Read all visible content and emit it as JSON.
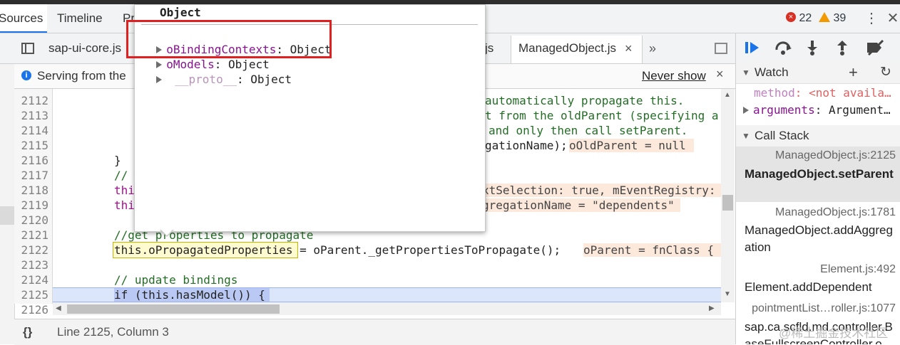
{
  "devtools_tabs": [
    "Sources",
    "Timeline",
    "Pr"
  ],
  "counts": {
    "errors": "22",
    "warnings": "39"
  },
  "file_tabs": [
    "sap-ui-core.js",
    "js",
    "ManagedObject.js",
    "»"
  ],
  "infobar": {
    "text": "Serving from the",
    "never_show": "Never show",
    "close": "×"
  },
  "popover": {
    "title": "Object",
    "rows": [
      {
        "name": "oBindingContexts",
        "value": ": Object"
      },
      {
        "name": "oModels",
        "value": ": Object"
      },
      {
        "name": "__proto__",
        "value": ": Object"
      }
    ]
  },
  "code": {
    "lines": [
      {
        "n": "2112",
        "text": "automatically propagate this."
      },
      {
        "n": "2113",
        "text": "t from the oldParent (specifying a"
      },
      {
        "n": "2114",
        "text": "and only then call setParent."
      },
      {
        "n": "2115",
        "text": "gationName);"
      },
      {
        "n": "2116",
        "text": "}"
      },
      {
        "n": "2117",
        "text": "//"
      },
      {
        "n": "2118",
        "text": "thi",
        "tail": "xtSelection: true, mEventRegistry:"
      },
      {
        "n": "2119",
        "text": "thi",
        "tail": "gregationName = \"dependents\""
      },
      {
        "n": "2120",
        "text": ""
      },
      {
        "n": "2121",
        "text": "//get properties to propagate"
      },
      {
        "n": "2122",
        "text": "this.oPropagatedProperties = oParent._getPropertiesToPropagate();"
      },
      {
        "n": "2123",
        "text": ""
      },
      {
        "n": "2124",
        "text": "// update bindings"
      },
      {
        "n": "2125",
        "text": "if (this.hasModel()) {"
      },
      {
        "n": "2126",
        "text": ""
      }
    ],
    "inline_values": {
      "l2115": "oOldParent = null",
      "l2122": "oParent = fnClass {"
    }
  },
  "statusbar": {
    "braces": "{}",
    "position": "Line 2125, Column 3"
  },
  "watch": {
    "title": "Watch",
    "items": [
      {
        "name": "method",
        "value": ": <not availa…"
      },
      {
        "name": "arguments",
        "value": ": Argument…"
      }
    ]
  },
  "call_stack": {
    "title": "Call Stack",
    "frames": [
      {
        "file": "ManagedObject.js:2125",
        "fn": "ManagedObject.setParent"
      },
      {
        "file": "ManagedObject.js:1781",
        "fn": "ManagedObject.addAggregation"
      },
      {
        "file": "Element.js:492",
        "fn": "Element.addDependent"
      },
      {
        "file": "pointmentList…roller.js:1077",
        "fn": "sap.ca.scfld.md.controller.BaseFullscreenController.o"
      }
    ]
  },
  "watermark": "@稀土掘金技术社区",
  "colors": {
    "accent": "#1a73e8",
    "highlight_box": "#e02020",
    "exec_line": "#dce6fb",
    "error": "#d93025",
    "warning": "#f29900"
  }
}
